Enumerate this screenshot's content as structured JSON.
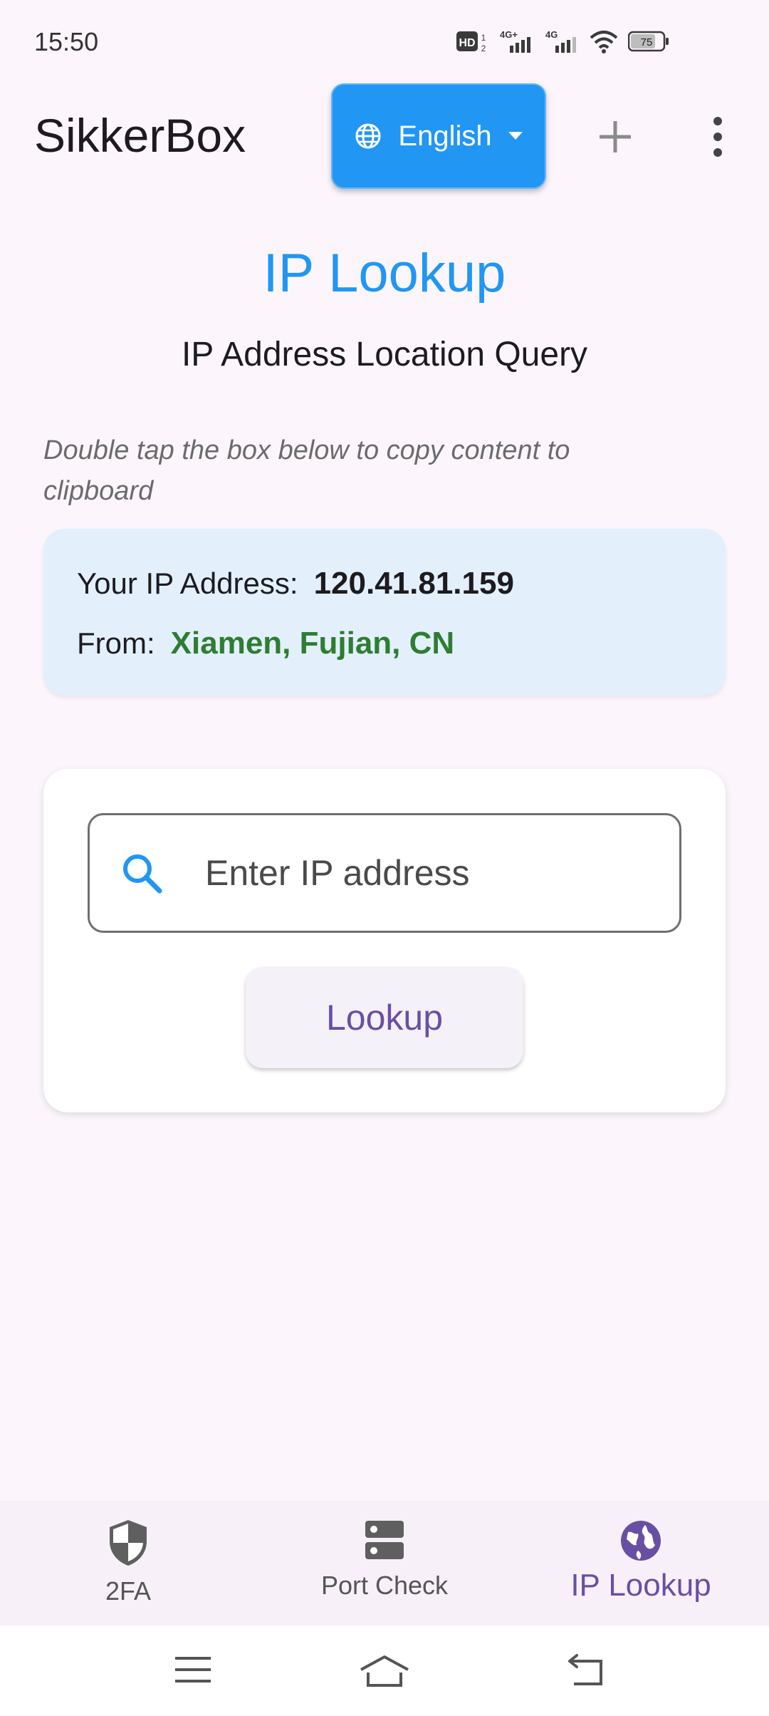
{
  "status_bar": {
    "time": "15:50",
    "battery": "75",
    "icons": [
      "hd-icon",
      "signal-4g-plus-icon",
      "signal-4g-icon",
      "wifi-icon",
      "battery-icon"
    ]
  },
  "app_bar": {
    "title": "SikkerBox",
    "language": "English",
    "add_icon": "plus-icon",
    "more_icon": "more-vert-icon"
  },
  "page": {
    "title": "IP Lookup",
    "subtitle": "IP Address Location Query",
    "hint": "Double tap the box below to copy content to clipboard"
  },
  "info": {
    "ip_label": "Your IP Address:",
    "ip_value": "120.41.81.159",
    "from_label": "From:",
    "from_value": "Xiamen, Fujian, CN"
  },
  "lookup": {
    "placeholder": "Enter IP address",
    "value": "",
    "button_label": "Lookup"
  },
  "bottom_nav": {
    "items": [
      {
        "label": "2FA",
        "icon": "shield-icon",
        "active": false
      },
      {
        "label": "Port Check",
        "icon": "server-icon",
        "active": false
      },
      {
        "label": "IP Lookup",
        "icon": "globe-icon",
        "active": true
      }
    ]
  },
  "colors": {
    "primary_blue": "#2196f3",
    "success_green": "#2e7d32",
    "accent_purple": "#6750a4",
    "info_card_bg": "#e3f0fb"
  }
}
